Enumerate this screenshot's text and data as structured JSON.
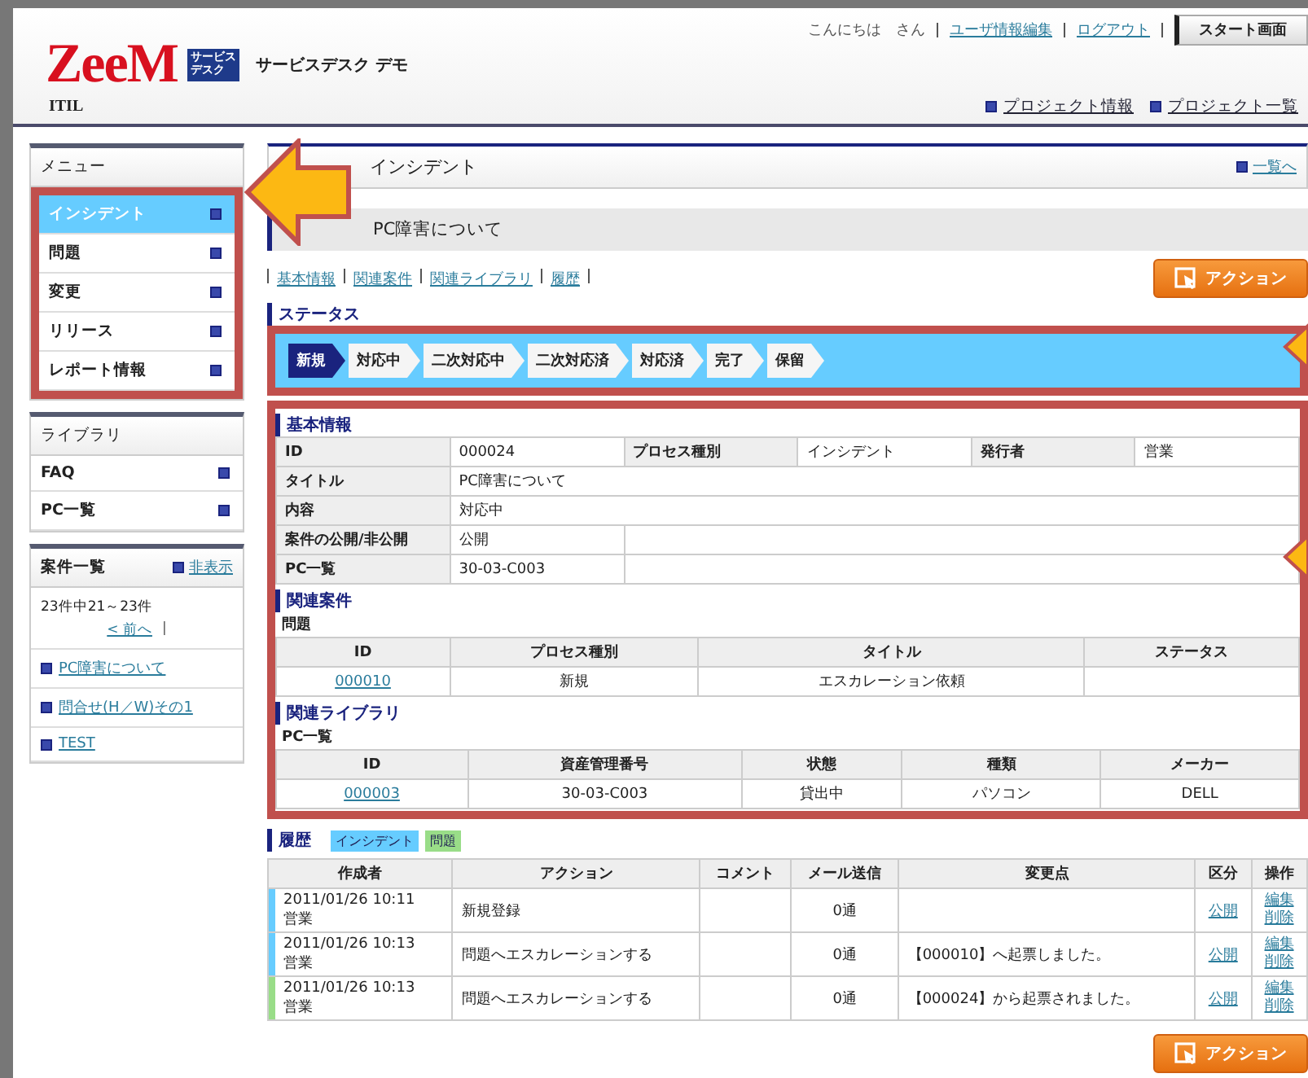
{
  "header": {
    "logo": "ZeeM",
    "logo_badge": [
      "サービス",
      "デスク"
    ],
    "app_name": "サービスデスク デモ",
    "greeting": "こんにちは　さん",
    "links": [
      "ユーザ情報編集",
      "ログアウト"
    ],
    "start_button": "スタート画面",
    "section": "ITIL",
    "project_links": [
      "プロジェクト情報",
      "プロジェクト一覧"
    ]
  },
  "sidebar": {
    "menu": {
      "title": "メニュー",
      "items": [
        {
          "label": "インシデント",
          "selected": true
        },
        {
          "label": "問題",
          "selected": false
        },
        {
          "label": "変更",
          "selected": false
        },
        {
          "label": "リリース",
          "selected": false
        },
        {
          "label": "レポート情報",
          "selected": false
        }
      ]
    },
    "library": {
      "title": "ライブラリ",
      "items": [
        "FAQ",
        "PC一覧"
      ]
    },
    "cases": {
      "title": "案件一覧",
      "hide_link": "非表示",
      "count": "23件中21～23件",
      "prev_link": "< 前へ",
      "separator": "|",
      "items": [
        "PC障害について",
        "問合せ(H／W)その1",
        "TEST"
      ]
    }
  },
  "page": {
    "title": "インシデント",
    "list_link": "一覧へ",
    "subtitle": "PC障害について",
    "tabs": [
      "基本情報",
      "関連案件",
      "関連ライブラリ",
      "履歴"
    ],
    "action_button": "アクション",
    "status_heading": "ステータス",
    "status_steps": [
      {
        "label": "新規",
        "selected": true
      },
      {
        "label": "対応中",
        "selected": false
      },
      {
        "label": "二次対応中",
        "selected": false
      },
      {
        "label": "二次対応済",
        "selected": false
      },
      {
        "label": "対応済",
        "selected": false
      },
      {
        "label": "完了",
        "selected": false
      },
      {
        "label": "保留",
        "selected": false
      }
    ]
  },
  "basic_info": {
    "heading": "基本情報",
    "rows": [
      {
        "cells": [
          {
            "text": "ID",
            "header": true
          },
          {
            "text": "000024"
          },
          {
            "text": "プロセス種別",
            "header": true
          },
          {
            "text": "インシデント"
          },
          {
            "text": "発行者",
            "header": true
          },
          {
            "text": "営業"
          }
        ]
      },
      {
        "cells": [
          {
            "text": "タイトル",
            "header": true
          },
          {
            "text": "PC障害について",
            "colspan": 5
          }
        ]
      },
      {
        "cells": [
          {
            "text": "内容",
            "header": true
          },
          {
            "text": "対応中",
            "colspan": 5
          }
        ]
      },
      {
        "cells": [
          {
            "text": "案件の公開/非公開",
            "header": true
          },
          {
            "text": "公開"
          },
          {
            "colspan": 4
          }
        ]
      },
      {
        "cells": [
          {
            "text": "PC一覧",
            "header": true
          },
          {
            "text": "30-03-C003"
          },
          {
            "colspan": 4
          }
        ]
      }
    ]
  },
  "related_cases": {
    "heading": "関連案件",
    "subheading": "問題",
    "columns": [
      "ID",
      "プロセス種別",
      "タイトル",
      "ステータス"
    ],
    "rows": [
      [
        "000010",
        "新規",
        "エスカレーション依頼",
        ""
      ]
    ]
  },
  "related_library": {
    "heading": "関連ライブラリ",
    "subheading": "PC一覧",
    "columns": [
      "ID",
      "資産管理番号",
      "状態",
      "種類",
      "メーカー"
    ],
    "rows": [
      [
        "000003",
        "30-03-C003",
        "貸出中",
        "パソコン",
        "DELL"
      ]
    ]
  },
  "history": {
    "heading": "履歴",
    "tags": [
      {
        "label": "インシデント",
        "color": "#66ccff"
      },
      {
        "label": "問題",
        "color": "#99dd88"
      }
    ],
    "columns": [
      "作成者",
      "アクション",
      "コメント",
      "メール送信",
      "変更点",
      "区分",
      "操作"
    ],
    "rows": [
      {
        "color": "#66ccff",
        "date": "2011/01/26 10:11",
        "creator": "営業",
        "action": "新規登録",
        "mail": "0通",
        "change": "",
        "category": "公開",
        "ops": [
          "編集",
          "削除"
        ]
      },
      {
        "color": "#66ccff",
        "date": "2011/01/26 10:13",
        "creator": "営業",
        "action": "問題へエスカレーションする",
        "mail": "0通",
        "change": "【000010】へ起票しました。",
        "category": "公開",
        "ops": [
          "編集",
          "削除"
        ]
      },
      {
        "color": "#99dd88",
        "date": "2011/01/26 10:13",
        "creator": "営業",
        "action": "問題へエスカレーションする",
        "mail": "0通",
        "change": "【000024】から起票されました。",
        "category": "公開",
        "ops": [
          "編集",
          "削除"
        ]
      }
    ]
  },
  "bottom_action_button": "アクション"
}
